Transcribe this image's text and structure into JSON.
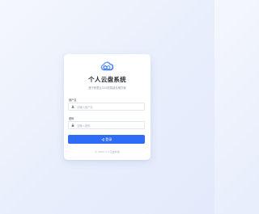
{
  "app": {
    "title": "个人云盘系统",
    "subtitle": "基于阿里云OSS的智能存储方案"
  },
  "form": {
    "username_label": "用户名",
    "username_placeholder": "请输入用户名",
    "password_label": "密码",
    "password_placeholder": "请输入密码",
    "login_label": "登录"
  },
  "footer": {
    "text": "© 2023 个人云盘系统"
  },
  "icons": {
    "logo": "cloud-link-icon",
    "username": "user-icon",
    "password": "lock-icon",
    "login": "login-arrow-icon"
  },
  "colors": {
    "accent": "#2f6cf6",
    "title": "#2a2f3a",
    "muted": "#8a93a3"
  }
}
